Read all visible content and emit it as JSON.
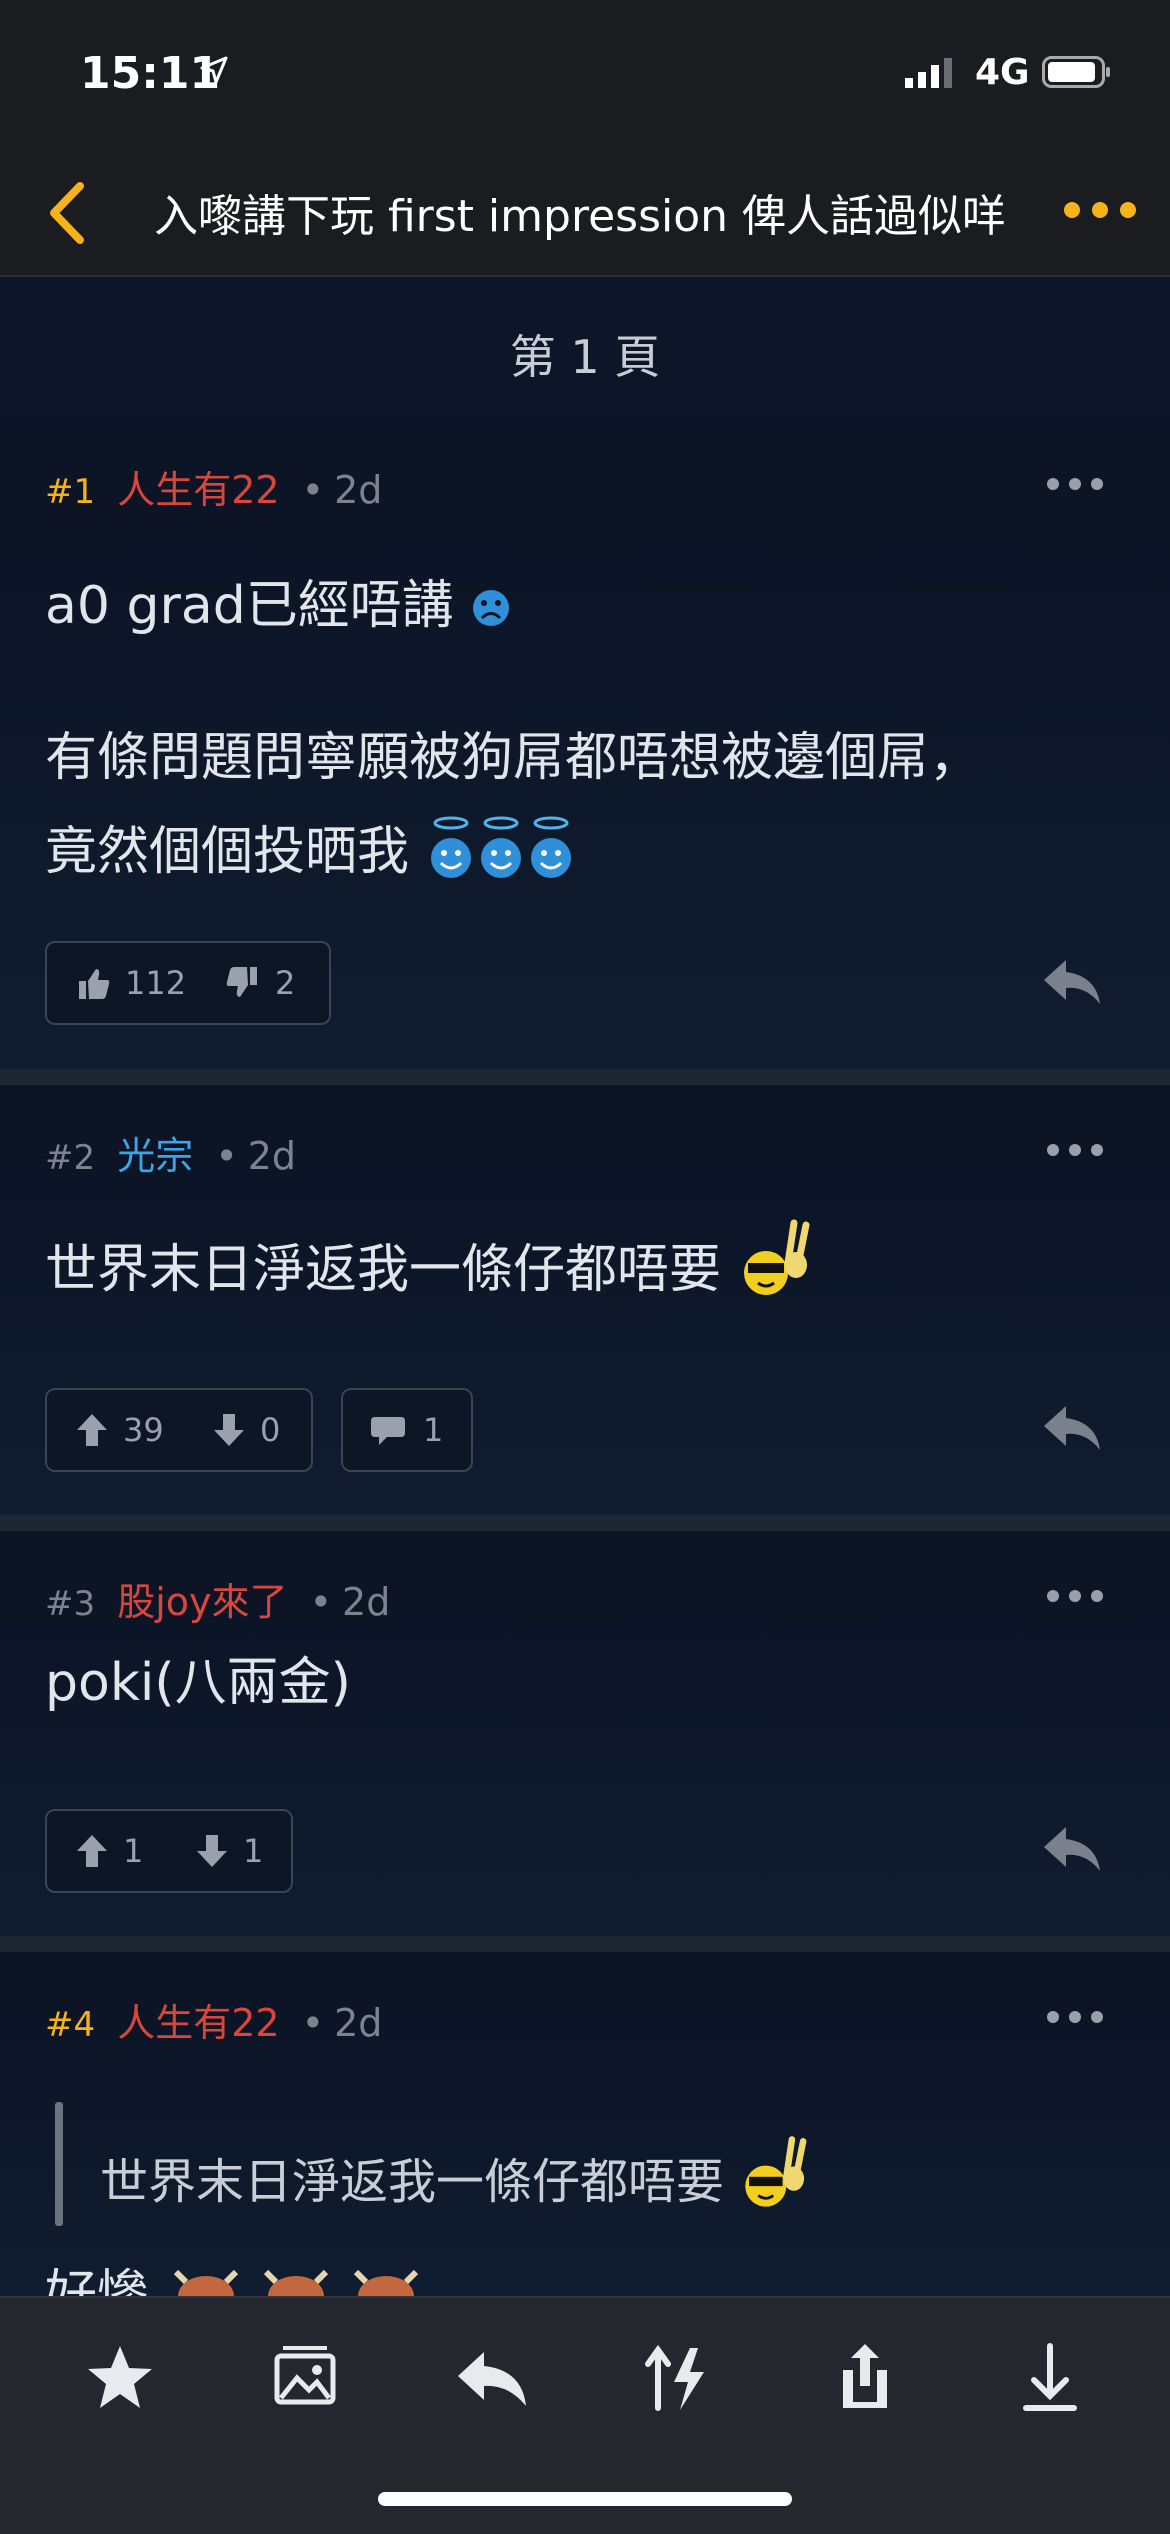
{
  "status": {
    "time": "15:11",
    "network": "4G",
    "icons": [
      "location-arrow-icon",
      "signal-icon",
      "battery-icon"
    ]
  },
  "nav": {
    "title": "入嚟講下玩 first impression 俾人話過似咩",
    "back_icon": "chevron-left-icon",
    "more_icon": "more-dots-icon"
  },
  "page": {
    "label": "第 1 頁"
  },
  "colors": {
    "accent": "#f5b21a",
    "user_red": "#d9463b",
    "user_blue": "#3aa6e8"
  },
  "posts": [
    {
      "num": "#1",
      "user": "人生有22",
      "time": "2d",
      "lines": [
        "a0 grad已經唔講",
        "有條問題問寧願被狗屌都唔想被邊個屌，",
        "竟然個個投晒我"
      ],
      "votes": {
        "up": "112",
        "down": "2"
      }
    },
    {
      "num": "#2",
      "user": "光宗",
      "time": "2d",
      "lines": [
        "世界末日淨返我一條仔都唔要"
      ],
      "votes": {
        "up": "39",
        "down": "0"
      },
      "comments": "1"
    },
    {
      "num": "#3",
      "user": "股joy來了",
      "time": "2d",
      "lines": [
        "poki(八兩金)"
      ],
      "votes": {
        "up": "1",
        "down": "1"
      }
    },
    {
      "num": "#4",
      "user": "人生有22",
      "time": "2d",
      "quote": "世界末日淨返我一條仔都唔要",
      "lines": [
        "好慘"
      ]
    }
  ],
  "toolbar": {
    "icons": [
      "star-icon",
      "gallery-icon",
      "reply-icon",
      "sort-icon",
      "share-icon",
      "download-icon"
    ]
  }
}
